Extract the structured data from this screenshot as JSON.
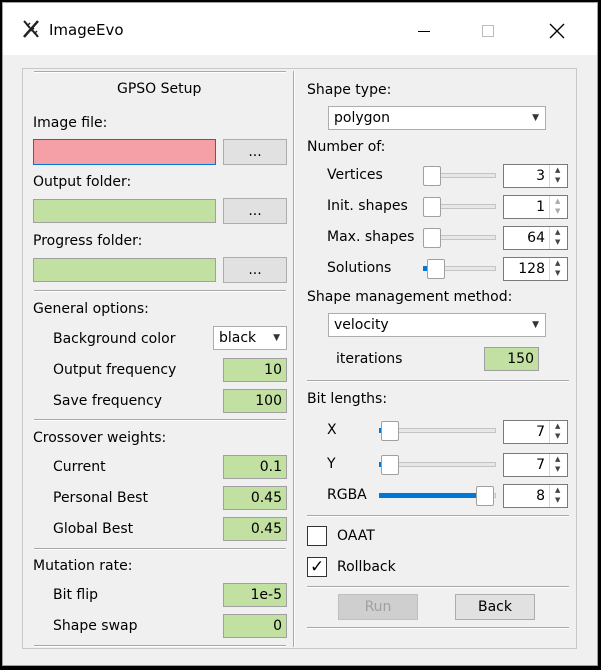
{
  "window": {
    "title": "ImageEvo"
  },
  "left": {
    "section_title": "GPSO Setup",
    "image_file": {
      "label": "Image file:",
      "value": "",
      "browse_label": "..."
    },
    "output_folder": {
      "label": "Output folder:",
      "value": "",
      "browse_label": "..."
    },
    "progress_folder": {
      "label": "Progress folder:",
      "value": "",
      "browse_label": "..."
    },
    "general": {
      "heading": "General options:",
      "background_color_label": "Background color",
      "background_color_value": "black",
      "output_frequency_label": "Output frequency",
      "output_frequency_value": "10",
      "save_frequency_label": "Save frequency",
      "save_frequency_value": "100"
    },
    "crossover": {
      "heading": "Crossover weights:",
      "current_label": "Current",
      "current_value": "0.1",
      "personal_best_label": "Personal Best",
      "personal_best_value": "0.45",
      "global_best_label": "Global Best",
      "global_best_value": "0.45"
    },
    "mutation": {
      "heading": "Mutation rate:",
      "bit_flip_label": "Bit flip",
      "bit_flip_value": "1e-5",
      "shape_swap_label": "Shape swap",
      "shape_swap_value": "0"
    }
  },
  "right": {
    "shape_type": {
      "label": "Shape type:",
      "value": "polygon"
    },
    "number_of": {
      "heading": "Number of:",
      "vertices_label": "Vertices",
      "vertices_value": "3",
      "init_shapes_label": "Init. shapes",
      "init_shapes_value": "1",
      "max_shapes_label": "Max. shapes",
      "max_shapes_value": "64",
      "solutions_label": "Solutions",
      "solutions_value": "128"
    },
    "shape_management": {
      "label": "Shape management method:",
      "value": "velocity",
      "iterations_label": "iterations",
      "iterations_value": "150"
    },
    "bit_lengths": {
      "heading": "Bit lengths:",
      "x_label": "X",
      "x_value": "7",
      "y_label": "Y",
      "y_value": "7",
      "rgba_label": "RGBA",
      "rgba_value": "8"
    },
    "oaat": {
      "label": "OAAT",
      "checked": false
    },
    "rollback": {
      "label": "Rollback",
      "checked": true,
      "mark": "✓"
    },
    "run_label": "Run",
    "back_label": "Back"
  },
  "colors": {
    "accent": "#0078d7",
    "valid_field": "#c1e0a1",
    "invalid_field": "#f4a0a6"
  }
}
